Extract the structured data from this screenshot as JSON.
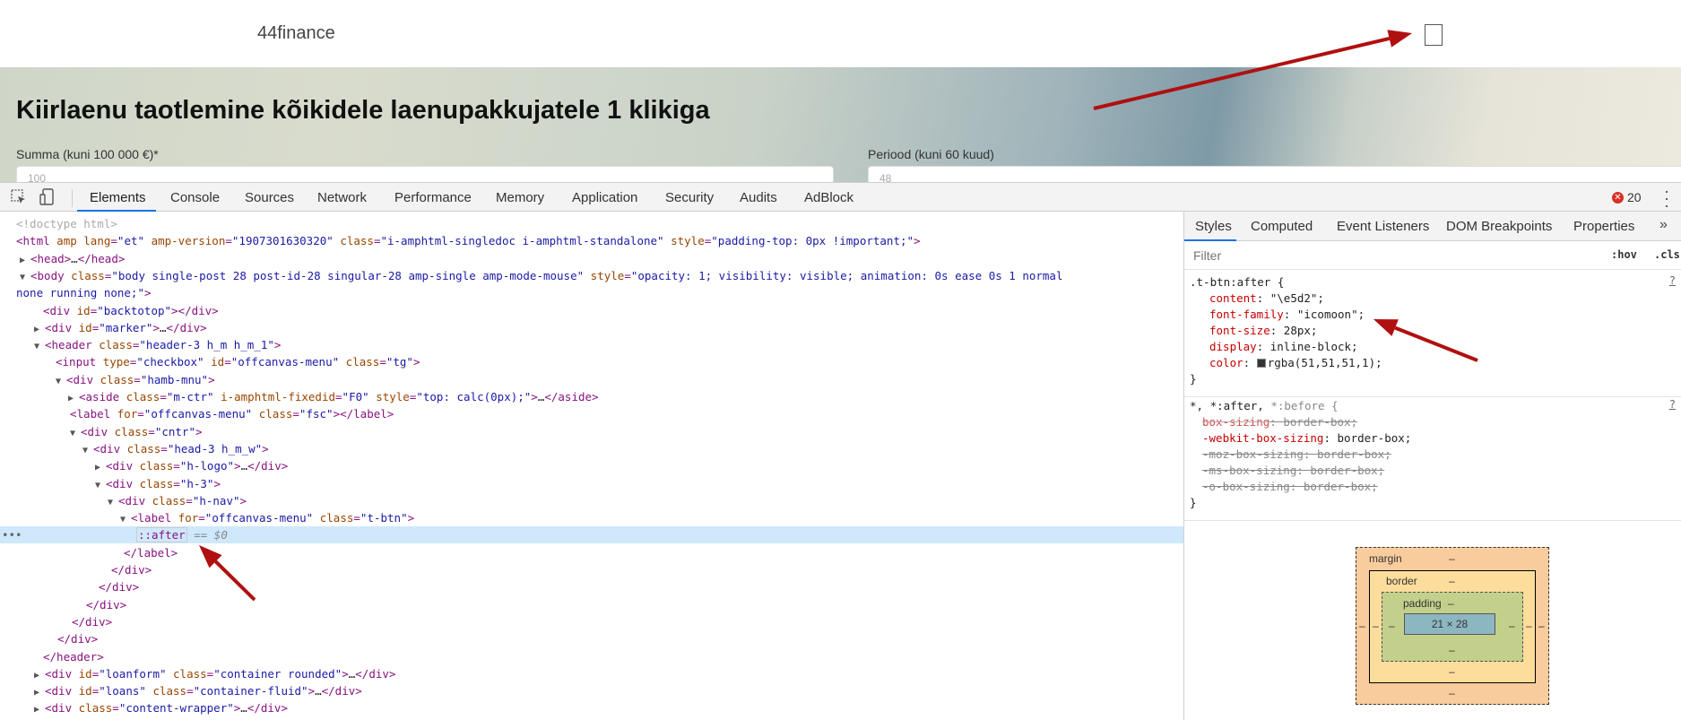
{
  "site": {
    "logo": "44finance",
    "hero_title": "Kiirlaenu taotlemine kõikidele laenupakkujatele 1 klikiga",
    "amount_label": "Summa (kuni 100 000 €)*",
    "amount_value": "100",
    "period_label": "Periood (kuni 60 kuud)",
    "period_value": "48"
  },
  "devtools": {
    "tabs": [
      "Elements",
      "Console",
      "Sources",
      "Network",
      "Performance",
      "Memory",
      "Application",
      "Security",
      "Audits",
      "AdBlock"
    ],
    "active_tab": "Elements",
    "error_count": "20",
    "icons": {
      "inspect": "inspect-element-icon",
      "device": "device-toolbar-icon",
      "error": "error-icon",
      "menu": "kebab-menu-icon"
    }
  },
  "dom_tree": [
    {
      "html": "<span class='cm'>&lt;!doctype html&gt;</span>"
    },
    {
      "html": "<span class='t'>&lt;html</span> <span class='an'>amp</span> <span class='an'>lang</span>=<span class='av'>\"et\"</span> <span class='an'>amp-version</span>=<span class='av'>\"1907301630320\"</span> <span class='an'>class</span>=<span class='av'>\"i-amphtml-singledoc i-amphtml-standalone\"</span> <span class='an'>style</span>=<span class='av'>\"padding-top: 0px !important;\"</span><span class='t'>&gt;</span>"
    },
    {
      "html": "<span class='tri'>▶</span><span class='t'>&lt;head&gt;</span><span class='tx'>…</span><span class='t'>&lt;/head&gt;</span>"
    },
    {
      "html": "<span class='tri'>▼</span><span class='t'>&lt;body</span> <span class='an'>class</span>=<span class='av'>\"body single-post 28 post-id-28 singular-28 amp-single amp-mode-mouse\"</span> <span class='an'>style</span>=<span class='av'>\"opacity: 1; visibility: visible; animation: 0s ease 0s 1 normal</span>"
    },
    {
      "html": "<span class='av'>none running none;\"</span><span class='t'>&gt;</span>"
    },
    {
      "html": "<span class='t'>&lt;div</span> <span class='an'>id</span>=<span class='av'>\"backtotop\"</span><span class='t'>&gt;&lt;/div&gt;</span>"
    },
    {
      "html": "<span class='tri'>▶</span><span class='t'>&lt;div</span> <span class='an'>id</span>=<span class='av'>\"marker\"</span><span class='t'>&gt;</span><span class='tx'>…</span><span class='t'>&lt;/div&gt;</span>"
    },
    {
      "html": "<span class='tri'>▼</span><span class='t'>&lt;header</span> <span class='an'>class</span>=<span class='av'>\"header-3 h_m h_m_1\"</span><span class='t'>&gt;</span>"
    },
    {
      "html": "<span class='t'>&lt;input</span> <span class='an'>type</span>=<span class='av'>\"checkbox\"</span> <span class='an'>id</span>=<span class='av'>\"offcanvas-menu\"</span> <span class='an'>class</span>=<span class='av'>\"tg\"</span><span class='t'>&gt;</span>"
    },
    {
      "html": "<span class='tri'>▼</span><span class='t'>&lt;div</span> <span class='an'>class</span>=<span class='av'>\"hamb-mnu\"</span><span class='t'>&gt;</span>"
    },
    {
      "html": "<span class='tri'>▶</span><span class='t'>&lt;aside</span> <span class='an'>class</span>=<span class='av'>\"m-ctr\"</span> <span class='an'>i-amphtml-fixedid</span>=<span class='av'>\"F0\"</span> <span class='an'>style</span>=<span class='av'>\"top: calc(0px);\"</span><span class='t'>&gt;</span><span class='tx'>…</span><span class='t'>&lt;/aside&gt;</span>"
    },
    {
      "html": "<span class='t'>&lt;label</span> <span class='an'>for</span>=<span class='av'>\"offcanvas-menu\"</span> <span class='an'>class</span>=<span class='av'>\"fsc\"</span><span class='t'>&gt;&lt;/label&gt;</span>"
    },
    {
      "html": "<span class='tri'>▼</span><span class='t'>&lt;div</span> <span class='an'>class</span>=<span class='av'>\"cntr\"</span><span class='t'>&gt;</span>"
    },
    {
      "html": "<span class='tri'>▼</span><span class='t'>&lt;div</span> <span class='an'>class</span>=<span class='av'>\"head-3 h_m_w\"</span><span class='t'>&gt;</span>"
    },
    {
      "html": "<span class='tri'>▶</span><span class='t'>&lt;div</span> <span class='an'>class</span>=<span class='av'>\"h-logo\"</span><span class='t'>&gt;</span><span class='tx'>…</span><span class='t'>&lt;/div&gt;</span>"
    },
    {
      "html": "<span class='tri'>▼</span><span class='t'>&lt;div</span> <span class='an'>class</span>=<span class='av'>\"h-3\"</span><span class='t'>&gt;</span>"
    },
    {
      "html": "<span class='tri'>▼</span><span class='t'>&lt;div</span> <span class='an'>class</span>=<span class='av'>\"h-nav\"</span><span class='t'>&gt;</span>"
    },
    {
      "html": "<span class='tri'>▼</span><span class='t'>&lt;label</span> <span class='an'>for</span>=<span class='av'>\"offcanvas-menu\"</span> <span class='an'>class</span>=<span class='av'>\"t-btn\"</span><span class='t'>&gt;</span>"
    },
    {
      "html": "<span class='pseudo'>::after</span> <span class='eq0'>== $0</span>"
    },
    {
      "html": "<span class='t'>&lt;/label&gt;</span>"
    },
    {
      "html": "<span class='t'>&lt;/div&gt;</span>"
    },
    {
      "html": "<span class='t'>&lt;/div&gt;</span>"
    },
    {
      "html": "<span class='t'>&lt;/div&gt;</span>"
    },
    {
      "html": "<span class='t'>&lt;/div&gt;</span>"
    },
    {
      "html": "<span class='t'>&lt;/div&gt;</span>"
    },
    {
      "html": "<span class='t'>&lt;/header&gt;</span>"
    },
    {
      "html": "<span class='tri'>▶</span><span class='t'>&lt;div</span> <span class='an'>id</span>=<span class='av'>\"loanform\"</span> <span class='an'>class</span>=<span class='av'>\"container rounded\"</span><span class='t'>&gt;</span><span class='tx'>…</span><span class='t'>&lt;/div&gt;</span>"
    },
    {
      "html": "<span class='tri'>▶</span><span class='t'>&lt;div</span> <span class='an'>id</span>=<span class='av'>\"loans\"</span> <span class='an'>class</span>=<span class='av'>\"container-fluid\"</span><span class='t'>&gt;</span><span class='tx'>…</span><span class='t'>&lt;/div&gt;</span>"
    },
    {
      "html": "<span class='tri'>▶</span><span class='t'>&lt;div</span> <span class='an'>class</span>=<span class='av'>\"content-wrapper\"</span><span class='t'>&gt;</span><span class='tx'>…</span><span class='t'>&lt;/div&gt;</span>"
    }
  ],
  "styles_pane": {
    "tabs": [
      "Styles",
      "Computed",
      "Event Listeners",
      "DOM Breakpoints",
      "Properties"
    ],
    "active_tab": "Styles",
    "more": "»",
    "filter_placeholder": "Filter",
    "hov": ":hov",
    "cls": ".cls",
    "rule1": {
      "selector": ".t-btn:after {",
      "source": "?",
      "props": [
        {
          "name": "content",
          "value": "\"\\e5d2\";"
        },
        {
          "name": "font-family",
          "value": "\"icomoon\";"
        },
        {
          "name": "font-size",
          "value": "28px;"
        },
        {
          "name": "display",
          "value": "inline-block;"
        },
        {
          "name": "color",
          "value": "rgba(51,51,51,1);",
          "swatch": "#333333"
        }
      ],
      "close": "}"
    },
    "rule2": {
      "selector_a": "*, *:after,",
      "selector_b": " *:before {",
      "source": "?",
      "props": [
        {
          "name": "box-sizing",
          "value": "border-box;",
          "struck": true
        },
        {
          "name": "-webkit-box-sizing",
          "value": "border-box;",
          "struck": false
        },
        {
          "name": "-moz-box-sizing",
          "value": "border-box;",
          "struck": true
        },
        {
          "name": "-ms-box-sizing",
          "value": "border-box;",
          "struck": true
        },
        {
          "name": "-o-box-sizing",
          "value": "border-box;",
          "struck": true
        }
      ],
      "close": "}"
    },
    "box_model": {
      "margin_label": "margin",
      "border_label": "border",
      "padding_label": "padding",
      "dash": "–",
      "content_size": "21 × 28"
    }
  },
  "annotation_color": "#b01010"
}
